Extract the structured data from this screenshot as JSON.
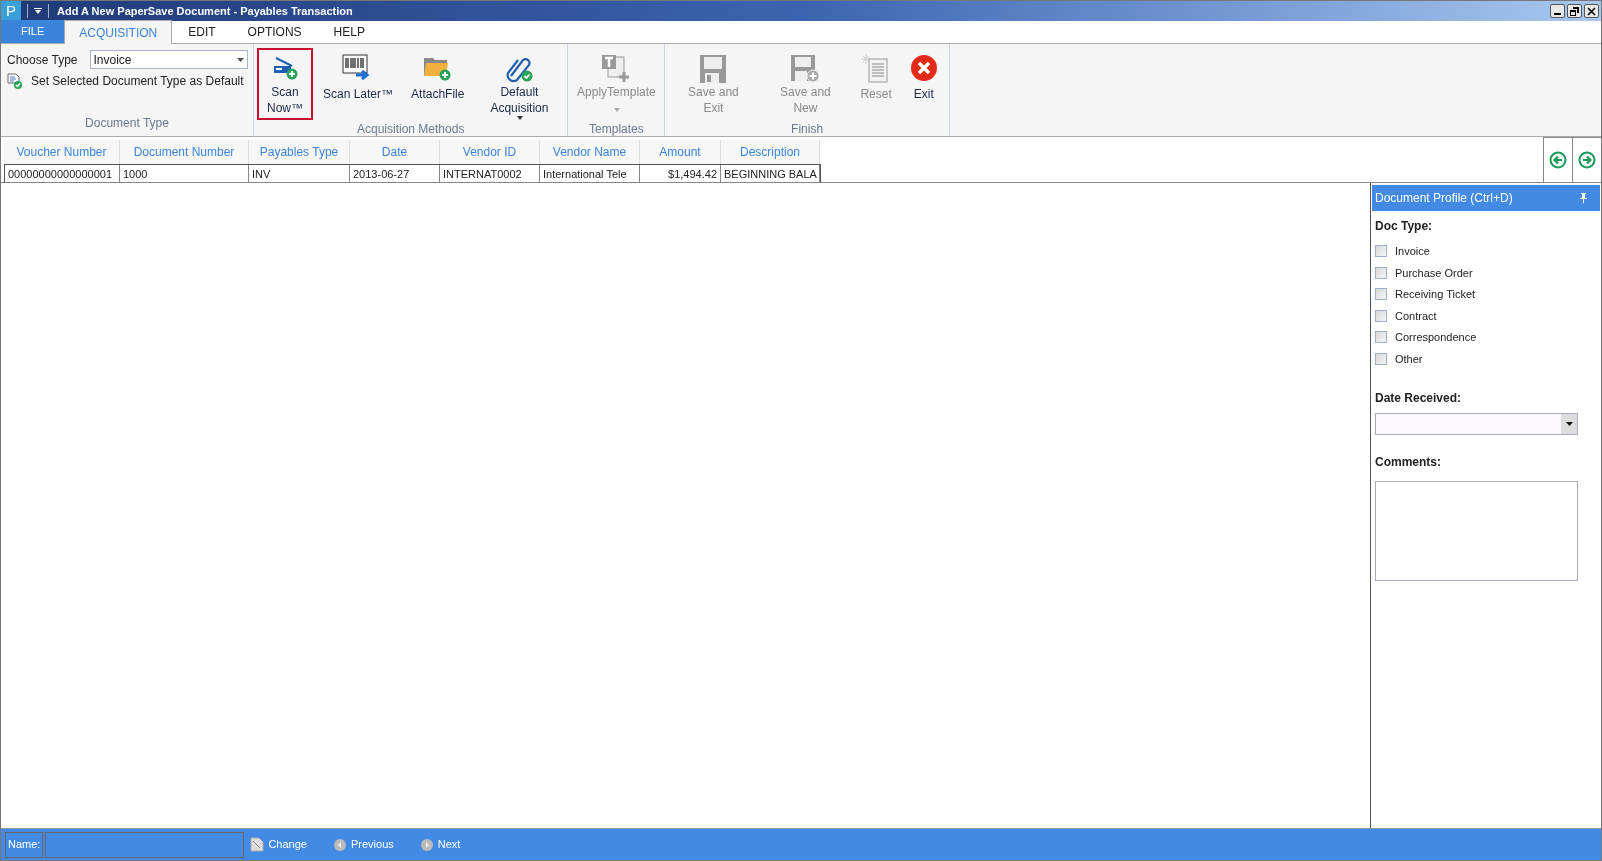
{
  "window": {
    "title": "Add A New PaperSave Document - Payables Transaction",
    "app_letter": "P"
  },
  "tabs": [
    {
      "label": "FILE",
      "kind": "file",
      "selected": false
    },
    {
      "label": "ACQUISITION",
      "kind": "tab",
      "selected": true
    },
    {
      "label": "EDIT",
      "kind": "tab",
      "selected": false
    },
    {
      "label": "OPTIONS",
      "kind": "tab",
      "selected": false
    },
    {
      "label": "HELP",
      "kind": "tab",
      "selected": false
    }
  ],
  "ribbon": {
    "document_type": {
      "choose_label": "Choose Type",
      "choose_value": "Invoice",
      "set_default": "Set Selected Document Type as Default",
      "group_label": "Document Type"
    },
    "groups": [
      {
        "label": "Acquisition Methods",
        "buttons": [
          {
            "label": "Scan Now™",
            "kind": "scanner",
            "selected": true,
            "disabled": false,
            "dropdown": false
          },
          {
            "label": "Scan Later™",
            "kind": "barcode",
            "selected": false,
            "disabled": false,
            "dropdown": false
          },
          {
            "label": "AttachFile",
            "kind": "folder",
            "selected": false,
            "disabled": false,
            "dropdown": false
          },
          {
            "label": "Default Acquisition",
            "kind": "paperclip",
            "selected": false,
            "disabled": false,
            "dropdown": true
          }
        ]
      },
      {
        "label": "Templates",
        "buttons": [
          {
            "label": "ApplyTemplate",
            "kind": "template",
            "selected": false,
            "disabled": true,
            "dropdown": true
          }
        ]
      },
      {
        "label": "Finish",
        "buttons": [
          {
            "label": "Save and Exit",
            "kind": "save",
            "selected": false,
            "disabled": true,
            "dropdown": false
          },
          {
            "label": "Save and New",
            "kind": "savenew",
            "selected": false,
            "disabled": true,
            "dropdown": false
          },
          {
            "label": "Reset",
            "kind": "reset",
            "selected": false,
            "disabled": true,
            "dropdown": false
          },
          {
            "label": "Exit",
            "kind": "exit",
            "selected": false,
            "disabled": false,
            "dropdown": false
          }
        ]
      }
    ]
  },
  "table": {
    "columns": [
      "Voucher Number",
      "Document Number",
      "Payables Type",
      "Date",
      "Vendor ID",
      "Vendor Name",
      "Amount",
      "Description"
    ],
    "rows": [
      [
        "00000000000000001",
        "1000",
        "INV",
        "2013-06-27",
        "INTERNAT0002",
        "International Tele",
        "$1,494.42",
        "BEGINNING BALA"
      ]
    ]
  },
  "document_profile": {
    "title": "Document Profile (Ctrl+D)",
    "doc_type_label": "Doc Type:",
    "doc_types": [
      {
        "label": "Invoice",
        "checked": false
      },
      {
        "label": "Purchase Order",
        "checked": false
      },
      {
        "label": "Receiving Ticket",
        "checked": false
      },
      {
        "label": "Contract",
        "checked": false
      },
      {
        "label": "Correspondence",
        "checked": false
      },
      {
        "label": "Other",
        "checked": false
      }
    ],
    "date_label": "Date Received:",
    "comments_label": "Comments:"
  },
  "status_bar": {
    "name_label": "Name:",
    "actions": [
      {
        "label": "Change",
        "kind": "change"
      },
      {
        "label": "Previous",
        "kind": "previous"
      },
      {
        "label": "Next",
        "kind": "next"
      }
    ]
  }
}
